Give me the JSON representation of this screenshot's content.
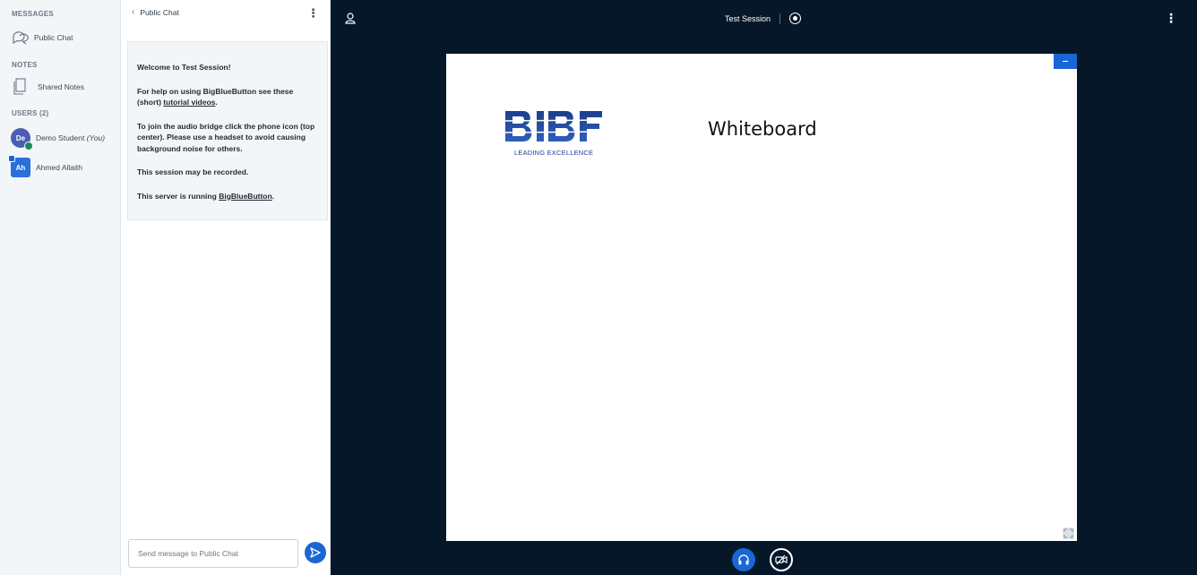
{
  "userlist": {
    "messages_title": "MESSAGES",
    "public_chat_label": "Public Chat",
    "notes_title": "NOTES",
    "shared_notes_label": "Shared Notes",
    "users_title": "USERS (2)",
    "users": [
      {
        "initials": "De",
        "name": "Demo Student",
        "suffix": "(You)"
      },
      {
        "initials": "Ah",
        "name": "Ahmed Allaith"
      }
    ]
  },
  "chat": {
    "title": "Public Chat",
    "welcome_heading": "Welcome to Test Session!",
    "help_text": "For help on using BigBlueButton see these (short)",
    "help_link": "tutorial videos",
    "help_end": ".",
    "audio_text": "To join the audio bridge click the phone icon (top center). Please use a headset to avoid causing background noise for others.",
    "recorded_text": "This session may be recorded.",
    "server_text": "This server is running",
    "server_link": "BigBlueButton",
    "server_end": ".",
    "input_placeholder": "Send message to Public Chat"
  },
  "main": {
    "session_title": "Test Session",
    "slide_logo": "BIBF",
    "slide_logo_tagline": "LEADING EXCELLENCE",
    "slide_title": "Whiteboard"
  },
  "colors": {
    "accent": "#1a66d4",
    "background_dark": "#06172a",
    "panel_light": "#f3f6f9"
  },
  "icons": {
    "public_chat": "chat-bubbles-icon",
    "shared_notes": "notes-icon",
    "user": "user-icon",
    "audio": "headphones-icon",
    "video": "video-off-icon",
    "send": "send-icon",
    "record": "record-icon"
  }
}
